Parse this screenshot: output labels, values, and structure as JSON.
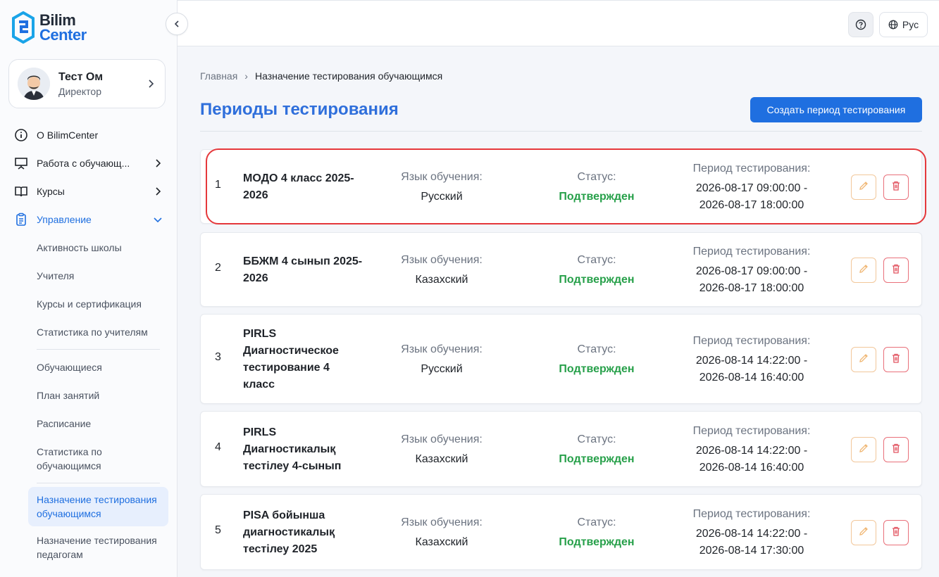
{
  "brand": {
    "line1": "Bilim",
    "line2": "Center"
  },
  "colors": {
    "accent": "#1f6fe0",
    "status_ok": "#27a04a",
    "danger": "#e9707a",
    "edit": "#f2c79a"
  },
  "profile": {
    "name": "Тест Ом",
    "role": "Директор"
  },
  "nav": {
    "about": "О BilimCenter",
    "students_work": "Работа с обучающ...",
    "courses": "Курсы",
    "management": "Управление",
    "sub": {
      "school_activity": "Активность школы",
      "teachers": "Учителя",
      "courses_cert": "Курсы и сертификация",
      "teacher_stats": "Статистика по учителям",
      "students": "Обучающиеся",
      "lesson_plan": "План занятий",
      "schedule": "Расписание",
      "student_stats": "Статистика по обучающимся",
      "assign_students": "Назначение тестирования обучающимся",
      "assign_teachers": "Назначение тестирования педагогам"
    }
  },
  "topbar": {
    "language": "Рус"
  },
  "breadcrumb": {
    "home": "Главная",
    "separator": "›",
    "current": "Назначение тестирования обучающимся"
  },
  "page": {
    "title": "Периоды тестирования",
    "create_button": "Создать период тестирования"
  },
  "labels": {
    "language": "Язык обучения:",
    "status": "Статус:",
    "period": "Период тестирования:"
  },
  "periods": [
    {
      "num": "1",
      "name": "МОДО 4 класс 2025-2026",
      "language": "Русский",
      "status": "Подтвержден",
      "start": "2026-08-17 09:00:00 -",
      "end": "2026-08-17 18:00:00"
    },
    {
      "num": "2",
      "name": "ББЖМ 4 сынып 2025-2026",
      "language": "Казахский",
      "status": "Подтвержден",
      "start": "2026-08-17 09:00:00 -",
      "end": "2026-08-17 18:00:00"
    },
    {
      "num": "3",
      "name": "PIRLS Диагностическое тестирование 4 класс",
      "language": "Русский",
      "status": "Подтвержден",
      "start": "2026-08-14 14:22:00 -",
      "end": "2026-08-14 16:40:00"
    },
    {
      "num": "4",
      "name": "PIRLS Диагностикалық тестілеу 4-сынып",
      "language": "Казахский",
      "status": "Подтвержден",
      "start": "2026-08-14 14:22:00 -",
      "end": "2026-08-14 16:40:00"
    },
    {
      "num": "5",
      "name": "PISA бойынша диагностикалық тестілеу 2025",
      "language": "Казахский",
      "status": "Подтвержден",
      "start": "2026-08-14 14:22:00 -",
      "end": "2026-08-14 17:30:00"
    }
  ]
}
